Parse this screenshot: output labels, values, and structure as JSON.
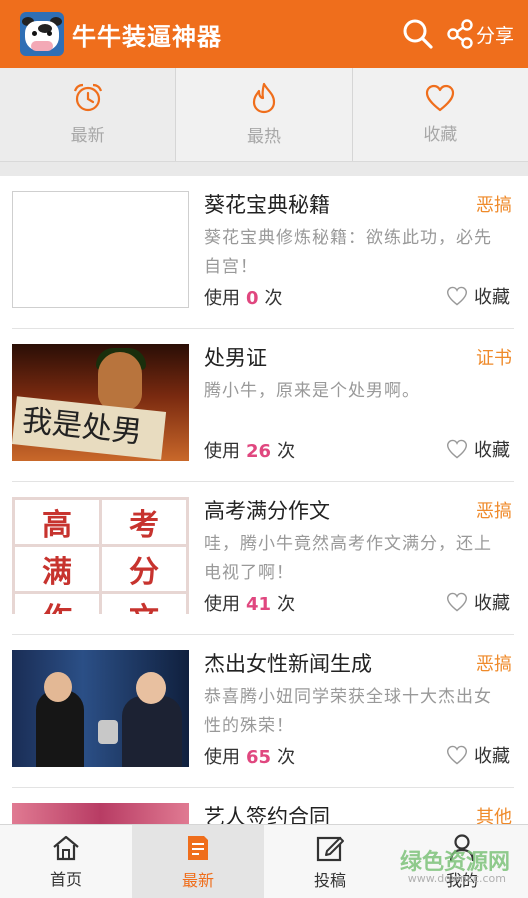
{
  "app": {
    "title": "牛牛装逼神器",
    "share_label": "分享"
  },
  "tabs": [
    {
      "label": "最新",
      "icon": "alarm-clock-icon"
    },
    {
      "label": "最热",
      "icon": "flame-icon"
    },
    {
      "label": "收藏",
      "icon": "heart-icon"
    }
  ],
  "list": {
    "usage_prefix": "使用",
    "usage_suffix": "次",
    "fav_label": "收藏",
    "items": [
      {
        "title": "葵花宝典秘籍",
        "tag": "恶搞",
        "desc": "葵花宝典修炼秘籍：欲练此功，必先自宫！",
        "count": "0"
      },
      {
        "title": "处男证",
        "tag": "证书",
        "desc": "腾小牛，原来是个处男啊。",
        "count": "26",
        "thumb_text": "我是处男"
      },
      {
        "title": "高考满分作文",
        "tag": "恶搞",
        "desc": "哇，腾小牛竟然高考作文满分，还上电视了啊！",
        "count": "41",
        "thumb_text": [
          "高",
          "考",
          "满",
          "分",
          "作",
          "文"
        ]
      },
      {
        "title": "杰出女性新闻生成",
        "tag": "恶搞",
        "desc": "恭喜腾小妞同学荣获全球十大杰出女性的殊荣！",
        "count": "65"
      },
      {
        "title": "艺人签约合同",
        "tag": "其他"
      }
    ]
  },
  "bottom_nav": [
    {
      "label": "首页",
      "icon": "home-icon"
    },
    {
      "label": "最新",
      "icon": "edit-list-icon"
    },
    {
      "label": "投稿",
      "icon": "compose-icon"
    },
    {
      "label": "我的",
      "icon": "user-icon"
    }
  ],
  "watermark": {
    "text": "绿色资源网",
    "url": "www.downcc.com"
  },
  "colors": {
    "brand": "#ef6e1c",
    "tag": "#ef8a2a",
    "count": "#e0477f"
  }
}
